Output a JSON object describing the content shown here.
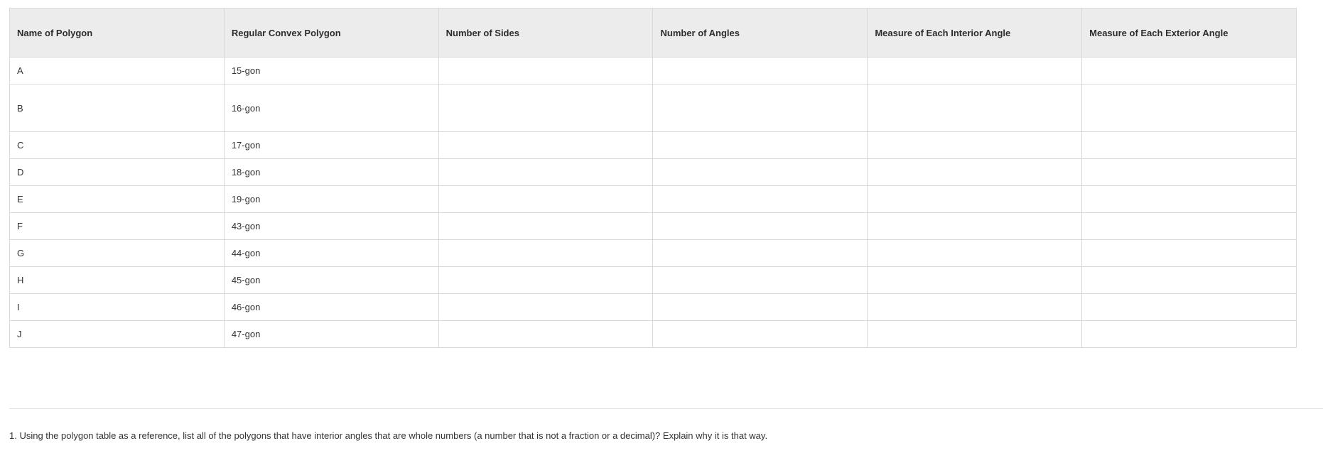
{
  "table": {
    "headers": [
      "Name of Polygon",
      "Regular Convex Polygon",
      "Number of Sides",
      "Number of Angles",
      "Measure of Each Interior Angle",
      "Measure of Each Exterior Angle"
    ],
    "rows": [
      {
        "name": "A",
        "polygon": "15-gon",
        "sides": "",
        "angles": "",
        "interior": "",
        "exterior": ""
      },
      {
        "name": "B",
        "polygon": "16-gon",
        "sides": "",
        "angles": "",
        "interior": "",
        "exterior": ""
      },
      {
        "name": "C",
        "polygon": "17-gon",
        "sides": "",
        "angles": "",
        "interior": "",
        "exterior": ""
      },
      {
        "name": "D",
        "polygon": "18-gon",
        "sides": "",
        "angles": "",
        "interior": "",
        "exterior": ""
      },
      {
        "name": "E",
        "polygon": "19-gon",
        "sides": "",
        "angles": "",
        "interior": "",
        "exterior": ""
      },
      {
        "name": "F",
        "polygon": "43-gon",
        "sides": "",
        "angles": "",
        "interior": "",
        "exterior": ""
      },
      {
        "name": "G",
        "polygon": "44-gon",
        "sides": "",
        "angles": "",
        "interior": "",
        "exterior": ""
      },
      {
        "name": "H",
        "polygon": "45-gon",
        "sides": "",
        "angles": "",
        "interior": "",
        "exterior": ""
      },
      {
        "name": "I",
        "polygon": "46-gon",
        "sides": "",
        "angles": "",
        "interior": "",
        "exterior": ""
      },
      {
        "name": "J",
        "polygon": "47-gon",
        "sides": "",
        "angles": "",
        "interior": "",
        "exterior": ""
      }
    ]
  },
  "question": "1. Using the polygon table as a reference, list all of the polygons that have interior angles that are whole numbers (a number that is not a fraction or a decimal)? Explain why it is that way."
}
